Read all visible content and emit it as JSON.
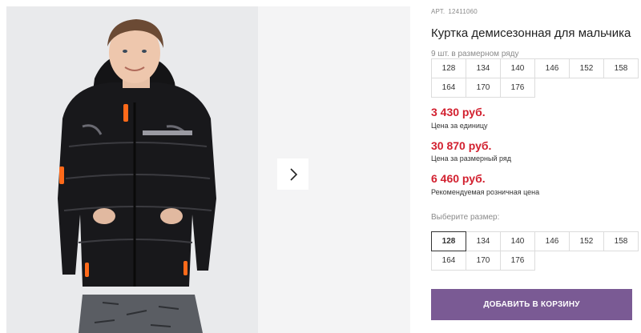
{
  "product": {
    "article_label": "АРТ.",
    "article_number": "12411060",
    "title": "Куртка демисезонная для мальчика"
  },
  "size_row": {
    "hint": "9 шт. в размерном ряду",
    "sizes": [
      "128",
      "134",
      "140",
      "146",
      "152",
      "158",
      "164",
      "170",
      "176"
    ]
  },
  "prices": {
    "unit_price": "3 430 руб.",
    "unit_label": "Цена за единицу",
    "row_price": "30 870 руб.",
    "row_label": "Цена за размерный ряд",
    "retail_price": "6 460 руб.",
    "retail_label": "Рекомендуемая розничная цена"
  },
  "size_select": {
    "label": "Выберите размер:",
    "selected": "128",
    "sizes": [
      "128",
      "134",
      "140",
      "146",
      "152",
      "158",
      "164",
      "170",
      "176"
    ]
  },
  "cart": {
    "button_label": "ДОБАВИТЬ В КОРЗИНУ"
  },
  "colors": {
    "price_red": "#d2202f",
    "button_purple": "#7a5a94"
  },
  "icons": {
    "next_arrow": "chevron-right-icon",
    "product_photo": "boy-in-black-jacket"
  }
}
